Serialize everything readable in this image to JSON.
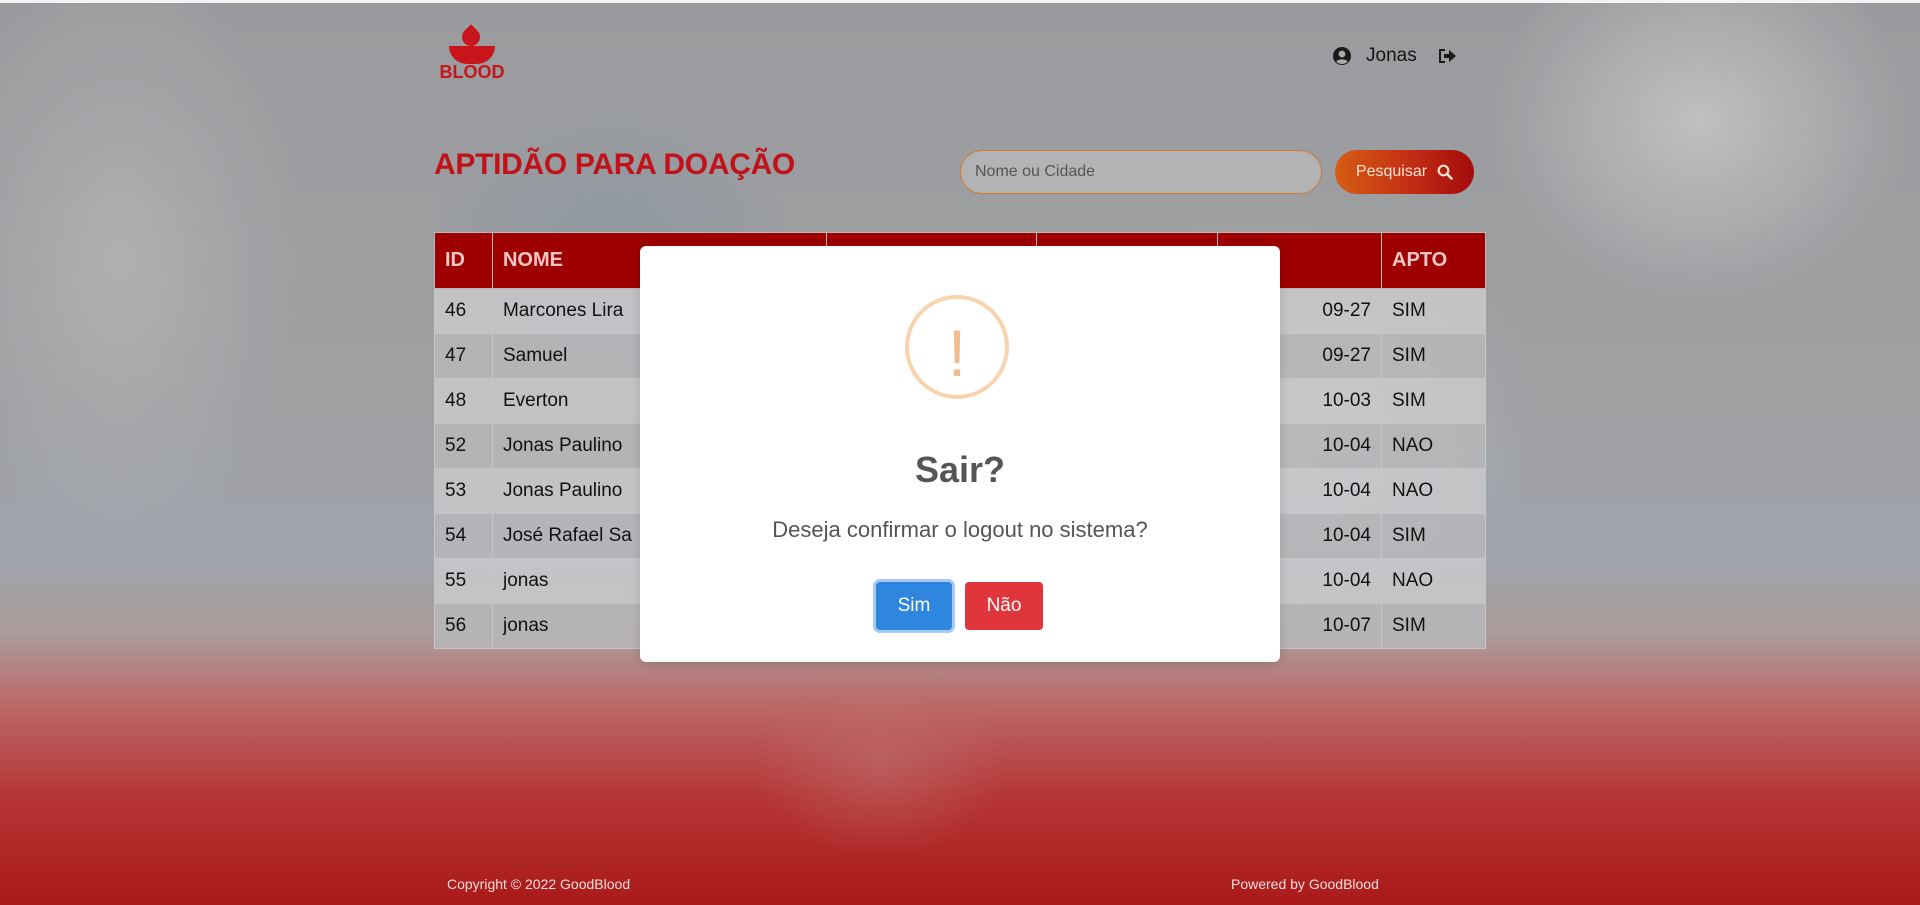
{
  "header": {
    "logo_text": "BLOOD",
    "user_name": "Jonas"
  },
  "main": {
    "title": "APTIDÃO PARA DOAÇÃO",
    "search": {
      "placeholder": "Nome ou Cidade",
      "value": "",
      "button_label": "Pesquisar"
    },
    "table": {
      "columns": [
        "ID",
        "NOME",
        "",
        "",
        "",
        "APTO"
      ],
      "rows": [
        {
          "id": "46",
          "nome": "Marcones Lira",
          "data": "09-27",
          "apto": "SIM"
        },
        {
          "id": "47",
          "nome": "Samuel",
          "data": "09-27",
          "apto": "SIM"
        },
        {
          "id": "48",
          "nome": "Everton",
          "data": "10-03",
          "apto": "SIM"
        },
        {
          "id": "52",
          "nome": "Jonas Paulino",
          "data": "10-04",
          "apto": "NAO"
        },
        {
          "id": "53",
          "nome": "Jonas Paulino",
          "data": "10-04",
          "apto": "NAO"
        },
        {
          "id": "54",
          "nome": "José Rafael Sa",
          "data": "10-04",
          "apto": "SIM"
        },
        {
          "id": "55",
          "nome": "jonas",
          "data": "10-04",
          "apto": "NAO"
        },
        {
          "id": "56",
          "nome": "jonas",
          "data": "10-07",
          "apto": "SIM"
        }
      ]
    }
  },
  "footer": {
    "copyright": "Copyright © 2022 GoodBlood",
    "powered": "Powered by GoodBlood"
  },
  "modal": {
    "icon": "!",
    "title": "Sair?",
    "text": "Deseja confirmar o logout no sistema?",
    "confirm_label": "Sim",
    "cancel_label": "Não"
  },
  "colors": {
    "brand": "#c1121a",
    "table_header": "#9e0000",
    "confirm": "#2f86de",
    "cancel": "#e0353a",
    "warning": "#f8bb86"
  }
}
